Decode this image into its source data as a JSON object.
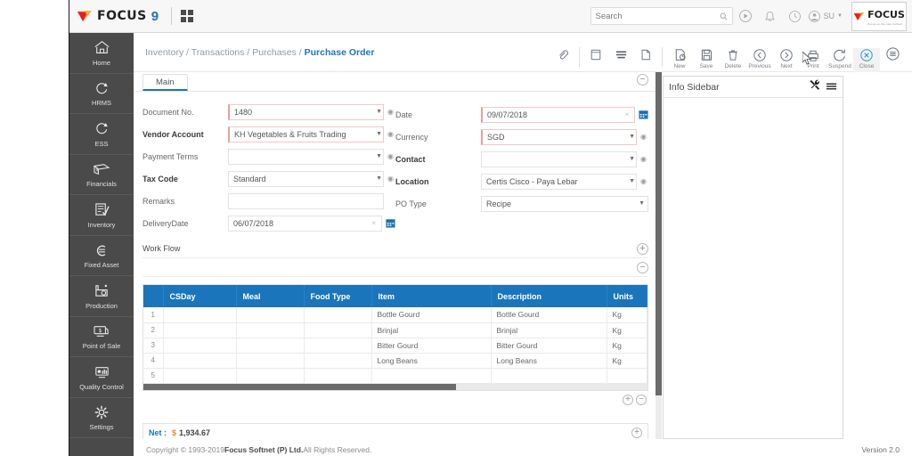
{
  "app": {
    "brand_name": "FOCUS",
    "brand_version": "9",
    "logo_text": "FOCUS",
    "logo_tagline": "Focus on the new horizon.",
    "grid_icon": "apps-grid-icon"
  },
  "topbar": {
    "search_placeholder": "Search",
    "search_value": "",
    "icons": [
      "play-circle-icon",
      "bell-icon",
      "history-clock-icon"
    ],
    "user_initials": "SU"
  },
  "breadcrumb": {
    "parts": [
      "Inventory",
      "Transactions",
      "Purchases"
    ],
    "current": "Purchase Order",
    "separator": "/"
  },
  "toolbar": {
    "plain_icons": [
      "attachment-icon",
      "note-icon",
      "list-lines-icon",
      "page-icon"
    ],
    "actions": [
      {
        "label": "New",
        "icon": "new-document-icon"
      },
      {
        "label": "Save",
        "icon": "save-disk-icon"
      },
      {
        "label": "Delete",
        "icon": "trash-icon"
      },
      {
        "label": "Previous",
        "icon": "arrow-left-circle-icon"
      },
      {
        "label": "Next",
        "icon": "arrow-right-circle-icon"
      },
      {
        "label": "Print",
        "icon": "printer-icon"
      },
      {
        "label": "Suspend",
        "icon": "refresh-circle-icon"
      },
      {
        "label": "Close",
        "icon": "close-circle-icon"
      }
    ],
    "menu_icon": "hamburger-circle-icon"
  },
  "sidebar": {
    "items": [
      {
        "label": "Home",
        "icon": "home-icon"
      },
      {
        "label": "HRMS",
        "icon": "refresh-cycle-icon"
      },
      {
        "label": "ESS",
        "icon": "refresh-cycle-icon"
      },
      {
        "label": "Financials",
        "icon": "money-icon"
      },
      {
        "label": "Inventory",
        "icon": "clipboard-check-icon"
      },
      {
        "label": "Fixed Asset",
        "icon": "asset-icon"
      },
      {
        "label": "Production",
        "icon": "factory-icon"
      },
      {
        "label": "Point of Sale",
        "icon": "pos-monitor-icon"
      },
      {
        "label": "Quality Control",
        "icon": "quality-chart-icon"
      },
      {
        "label": "Settings",
        "icon": "gear-icon"
      }
    ]
  },
  "form": {
    "tab_label": "Main",
    "left_fields": [
      {
        "label": "Document No.",
        "value": "1480",
        "bold": false,
        "required": true,
        "caret": true,
        "gear": true,
        "type": "lookup"
      },
      {
        "label": "Vendor Account",
        "value": "KH Vegetables & Fruits Trading",
        "bold": true,
        "required": true,
        "caret": true,
        "gear": true,
        "type": "lookup"
      },
      {
        "label": "Payment Terms",
        "value": "",
        "bold": false,
        "required": false,
        "caret": true,
        "gear": true,
        "type": "lookup"
      },
      {
        "label": "Tax Code",
        "value": "Standard",
        "bold": true,
        "required": false,
        "caret": true,
        "gear": true,
        "type": "lookup"
      },
      {
        "label": "Remarks",
        "value": "",
        "bold": false,
        "required": false,
        "caret": false,
        "gear": false,
        "type": "text"
      },
      {
        "label": "DeliveryDate",
        "value": "06/07/2018",
        "bold": false,
        "required": false,
        "caret": false,
        "gear": false,
        "type": "date"
      }
    ],
    "right_fields": [
      {
        "label": "Date",
        "value": "09/07/2018",
        "bold": false,
        "required": true,
        "caret": false,
        "gear": false,
        "type": "date"
      },
      {
        "label": "Currency",
        "value": "SGD",
        "bold": false,
        "required": true,
        "caret": true,
        "gear": true,
        "type": "lookup"
      },
      {
        "label": "Contact",
        "value": "",
        "bold": true,
        "required": false,
        "caret": true,
        "gear": true,
        "type": "lookup"
      },
      {
        "label": "Location",
        "value": "Certis Cisco - Paya Lebar",
        "bold": true,
        "required": false,
        "caret": true,
        "gear": true,
        "type": "lookup"
      },
      {
        "label": "PO Type",
        "value": "Recipe",
        "bold": false,
        "required": false,
        "caret": true,
        "gear": false,
        "type": "select"
      }
    ],
    "workflow_label": "Work Flow"
  },
  "grid": {
    "columns": [
      "",
      "CSDay",
      "Meal",
      "Food Type",
      "Item",
      "Description",
      "Units"
    ],
    "rows": [
      {
        "no": "1",
        "csday": "",
        "meal": "",
        "food_type": "",
        "item": "Bottle Gourd",
        "description": "Bottle Gourd",
        "units": "Kg"
      },
      {
        "no": "2",
        "csday": "",
        "meal": "",
        "food_type": "",
        "item": "Brinjal",
        "description": "Brinjal",
        "units": "Kg"
      },
      {
        "no": "3",
        "csday": "",
        "meal": "",
        "food_type": "",
        "item": "Bitter Gourd",
        "description": "Bitter Gourd",
        "units": "Kg"
      },
      {
        "no": "4",
        "csday": "",
        "meal": "",
        "food_type": "",
        "item": "Long Beans",
        "description": "Long Beans",
        "units": "Kg"
      },
      {
        "no": "5",
        "csday": "",
        "meal": "",
        "food_type": "",
        "item": "",
        "description": "",
        "units": ""
      }
    ]
  },
  "totals": {
    "net_label": "Net :",
    "currency_symbol": "$",
    "net_value": "1,934.67"
  },
  "info_sidebar": {
    "title": "Info Sidebar",
    "icons": [
      "tools-icon",
      "hamburger-icon"
    ]
  },
  "footer": {
    "copyright_prefix": "Copyright © 1993-2019 ",
    "company": "Focus Softnet (P) Ltd.",
    "copyright_suffix": " All Rights Reserved.",
    "version": "Version 2.0"
  },
  "colors": {
    "accent_blue": "#1b75bb",
    "sidebar_bg": "#4a4a4a",
    "orange": "#f28b2b",
    "required_red": "#e8a0a0"
  }
}
